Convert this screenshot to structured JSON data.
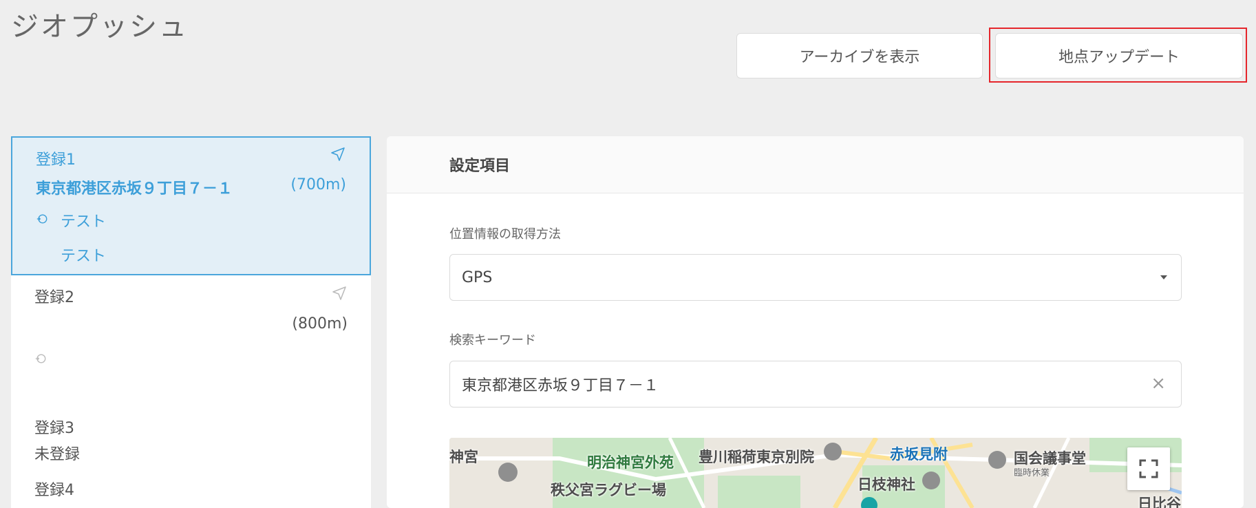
{
  "app": {
    "title": "ジオプッシュ"
  },
  "actions": {
    "archive_label": "アーカイブを表示",
    "update_label": "地点アップデート"
  },
  "list": {
    "items": [
      {
        "name": "登録1",
        "address": "東京都港区赤坂９丁目７－１",
        "distance": "(700m)",
        "sub1": "テスト",
        "sub2": "テスト",
        "selected": true
      },
      {
        "name": "登録2",
        "address": "",
        "distance": "(800m)",
        "sub1": "",
        "sub2": "",
        "selected": false
      },
      {
        "name": "登録3",
        "status": "未登録"
      },
      {
        "name": "登録4"
      }
    ]
  },
  "settings": {
    "header": "設定項目",
    "location_method": {
      "label": "位置情報の取得方法",
      "value": "GPS"
    },
    "search_keyword": {
      "label": "検索キーワード",
      "value": "東京都港区赤坂９丁目７－１",
      "clear_icon": "×"
    },
    "map": {
      "labels": [
        "神宮",
        "明治神宮外苑",
        "豊川稲荷東京別院",
        "赤坂見附",
        "国会議事堂",
        "臨時休業",
        "秩父宮ラグビー場",
        "日枝神社",
        "日比谷"
      ]
    }
  },
  "colors": {
    "accent": "#3d9fd9",
    "highlight": "#e5252b",
    "selected_bg": "#e3eff7"
  }
}
